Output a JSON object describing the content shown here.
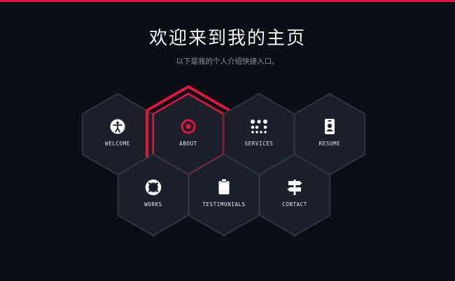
{
  "page": {
    "title": "欢迎来到我的主页",
    "subtitle": "以下是我的个人介绍快捷入口。"
  },
  "colors": {
    "background": "#0d0f17",
    "hex_fill": "#1c202b",
    "hex_border": "#2e3340",
    "accent": "#e0163f",
    "icon": "#ffffff"
  },
  "tiles": [
    {
      "label": "WELCOME",
      "icon": "accessibility-icon",
      "active": false
    },
    {
      "label": "ABOUT",
      "icon": "target-icon",
      "active": true
    },
    {
      "label": "SERVICES",
      "icon": "dots-grid-icon",
      "active": false
    },
    {
      "label": "RESUME",
      "icon": "id-badge-icon",
      "active": false
    },
    {
      "label": "WORKS",
      "icon": "lifebuoy-icon",
      "active": false
    },
    {
      "label": "TESTIMONIALS",
      "icon": "clipboard-icon",
      "active": false
    },
    {
      "label": "CONTACT",
      "icon": "signpost-icon",
      "active": false
    }
  ]
}
